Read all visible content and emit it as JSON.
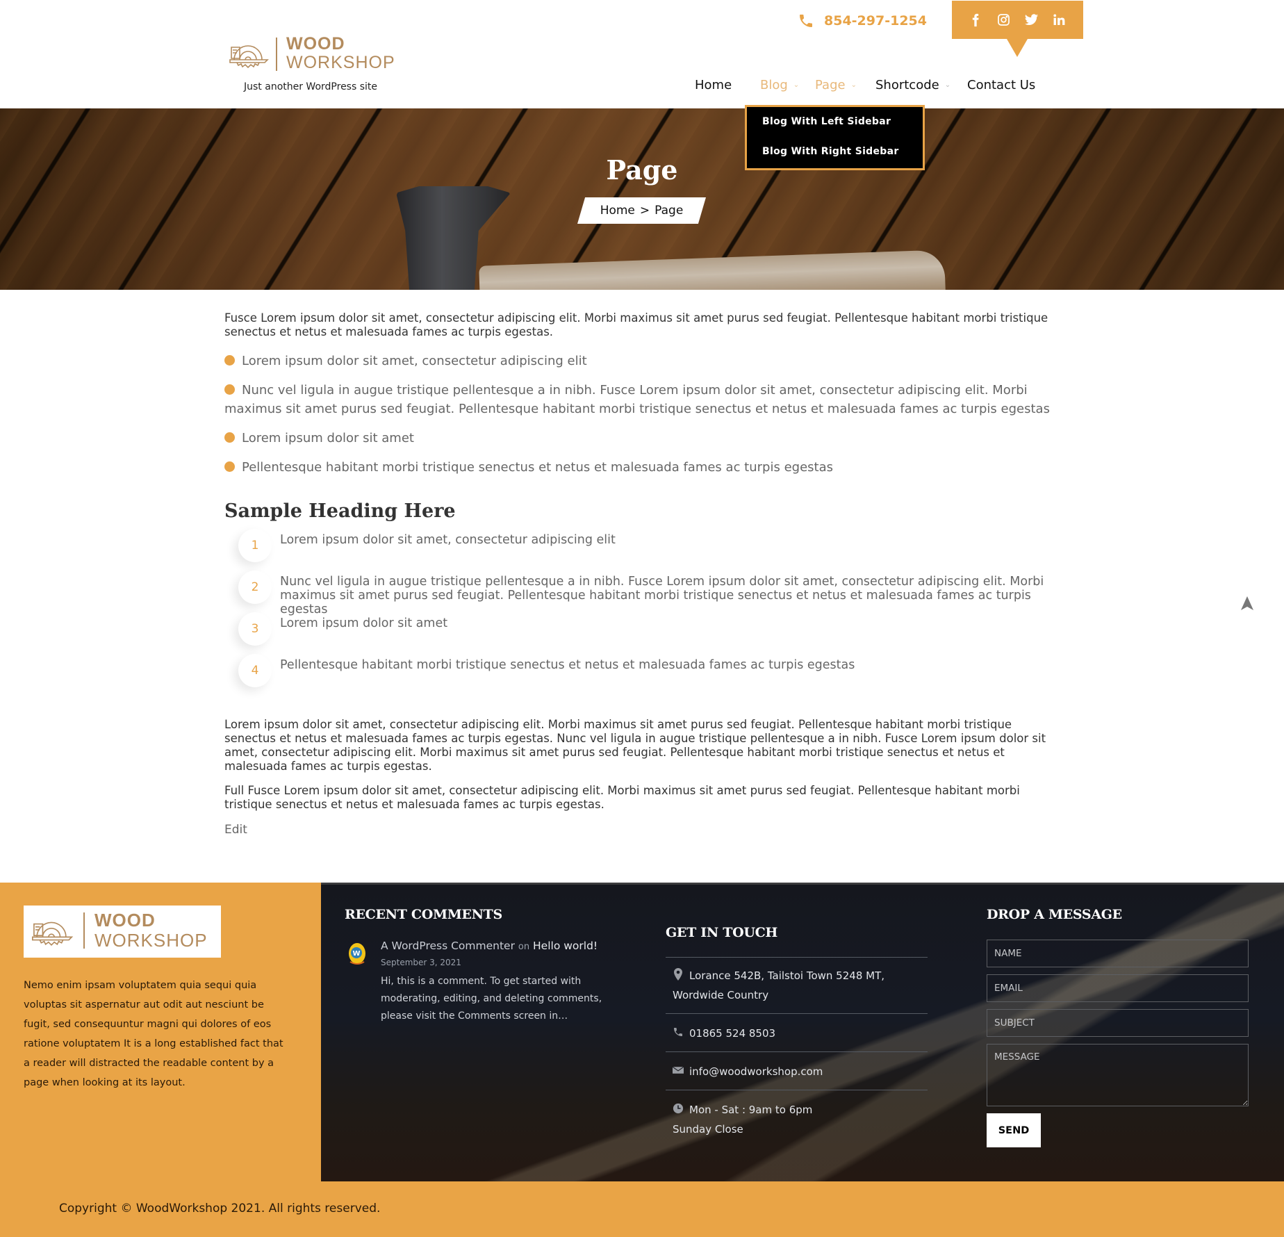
{
  "brand": {
    "logo_line1": "WOOD",
    "logo_line2": "WORKSHOP",
    "tagline": "Just another WordPress site",
    "accent_color": "#e8a346",
    "logo_color": "#b38b5d"
  },
  "topbar": {
    "phone": "854-297-1254",
    "phone_icon": "phone-icon",
    "social": [
      {
        "name": "facebook-icon",
        "glyph": "f"
      },
      {
        "name": "instagram-icon",
        "glyph": "◎"
      },
      {
        "name": "twitter-icon",
        "glyph": "🐦"
      },
      {
        "name": "linkedin-icon",
        "glyph": "in"
      }
    ]
  },
  "nav": {
    "items": [
      {
        "label": "Home",
        "has_children": false,
        "active": false
      },
      {
        "label": "Blog",
        "has_children": true,
        "active": true
      },
      {
        "label": "Page",
        "has_children": true,
        "active": true
      },
      {
        "label": "Shortcode",
        "has_children": true,
        "active": false
      },
      {
        "label": "Contact Us",
        "has_children": false,
        "active": false
      }
    ],
    "chevron": "⌄",
    "blog_dropdown": [
      "Blog With Left Sidebar",
      "Blog With Right Sidebar"
    ]
  },
  "hero": {
    "title": "Page",
    "breadcrumb": {
      "home": "Home",
      "separator": ">",
      "current": "Page"
    }
  },
  "content": {
    "intro": "Fusce Lorem ipsum dolor sit amet, consectetur adipiscing elit. Morbi maximus sit amet purus sed feugiat. Pellentesque habitant morbi tristique senectus et netus et malesuada fames ac turpis egestas.",
    "bullets": [
      "Lorem ipsum dolor sit amet, consectetur adipiscing elit",
      "Nunc vel ligula in augue tristique pellentesque a in nibh. Fusce Lorem ipsum dolor sit amet, consectetur adipiscing elit. Morbi maximus sit amet purus sed feugiat. Pellentesque habitant morbi tristique senectus et netus et malesuada fames ac turpis egestas",
      "Lorem ipsum dolor sit amet",
      "Pellentesque habitant morbi tristique senectus et netus et malesuada fames ac turpis egestas"
    ],
    "heading": "Sample Heading Here",
    "numbered": [
      {
        "num": "1",
        "text": "Lorem ipsum dolor sit amet, consectetur adipiscing elit"
      },
      {
        "num": "2",
        "text": "Nunc vel ligula in augue tristique pellentesque a in nibh. Fusce Lorem ipsum dolor sit amet, consectetur adipiscing elit. Morbi maximus sit amet purus sed feugiat. Pellentesque habitant morbi tristique senectus et netus et malesuada fames ac turpis egestas"
      },
      {
        "num": "3",
        "text": "Lorem ipsum dolor sit amet"
      },
      {
        "num": "4",
        "text": "Pellentesque habitant morbi tristique senectus et netus et malesuada fames ac turpis egestas"
      }
    ],
    "para2": "Lorem ipsum dolor sit amet, consectetur adipiscing elit. Morbi maximus sit amet purus sed feugiat. Pellentesque habitant morbi tristique senectus et netus et malesuada fames ac turpis egestas. Nunc vel ligula in augue tristique pellentesque a in nibh. Fusce Lorem ipsum dolor sit amet, consectetur adipiscing elit. Morbi maximus sit amet purus sed feugiat. Pellentesque habitant morbi tristique senectus et netus et malesuada fames ac turpis egestas.",
    "para3": "Full Fusce Lorem ipsum dolor sit amet, consectetur adipiscing elit. Morbi maximus sit amet purus sed feugiat. Pellentesque habitant morbi tristique senectus et netus et malesuada fames ac turpis egestas.",
    "edit_label": "Edit"
  },
  "scroll_top_icon": "arrow-up-icon",
  "footer": {
    "about": "Nemo enim ipsam voluptatem quia sequi quia voluptas sit aspernatur aut odit aut nesciunt be fugit, sed consequuntur magni qui dolores of eos ratione voluptatem It is a long established fact that a reader will distracted the readable content by a page when looking at its layout.",
    "recent_comments": {
      "title": "RECENT COMMENTS",
      "items": [
        {
          "author": "A WordPress Commenter",
          "on": "on",
          "post": "Hello world!",
          "date": "September 3, 2021",
          "excerpt": "Hi, this is a comment. To get started with moderating, editing, and deleting comments, please visit the Comments screen in…"
        }
      ]
    },
    "get_in_touch": {
      "title": "GET IN TOUCH",
      "address": "Lorance 542B, Tailstoi Town 5248 MT, Wordwide Country",
      "phone": "01865 524 8503",
      "email": "info@woodworkshop.com",
      "hours_line1": "Mon - Sat : 9am to 6pm",
      "hours_line2": "Sunday Close"
    },
    "drop_message": {
      "title": "DROP A MESSAGE",
      "name_placeholder": "NAME",
      "email_placeholder": "EMAIL",
      "subject_placeholder": "SUBJECT",
      "message_placeholder": "MESSAGE",
      "name_value": "",
      "email_value": "",
      "subject_value": "",
      "message_value": "",
      "send_label": "SEND"
    },
    "copyright": "Copyright © WoodWorkshop 2021. All rights reserved."
  }
}
